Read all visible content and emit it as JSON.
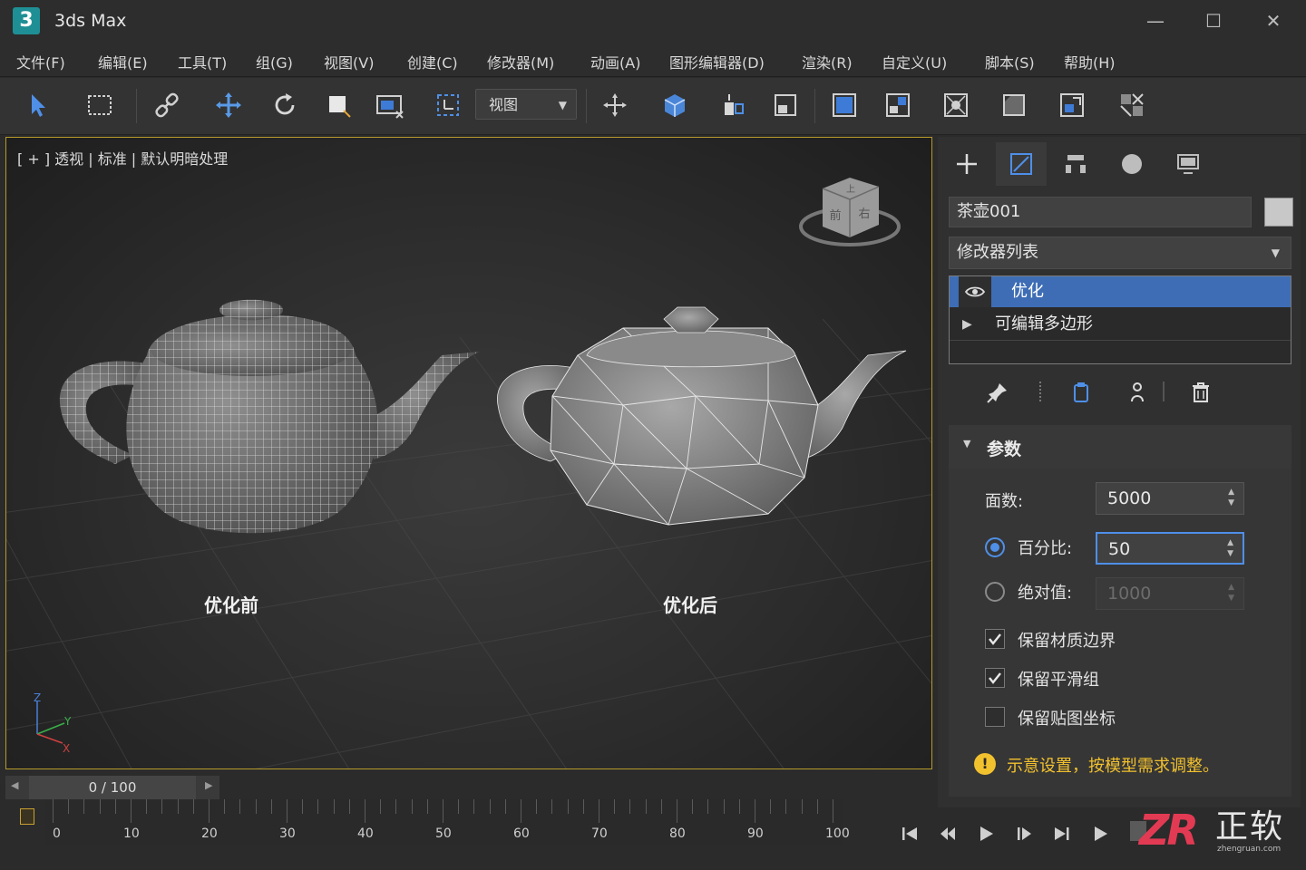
{
  "window": {
    "app_icon_text": "3",
    "title": "3ds Max"
  },
  "menu": [
    "文件(F)",
    "编辑(E)",
    "工具(T)",
    "组(G)",
    "视图(V)",
    "创建(C)",
    "修改器(M)",
    "动画(A)",
    "图形编辑器(D)",
    "渲染(R)",
    "自定义(U)",
    "脚本(S)",
    "帮助(H)"
  ],
  "toolbar": {
    "view_dropdown": "视图"
  },
  "viewport": {
    "label": "[ + ]  透视  |  标准  |  默认明暗处理",
    "caption_before": "优化前",
    "caption_after": "优化后",
    "viewcube": {
      "top": "上",
      "front": "前",
      "right": "右"
    },
    "axes": {
      "x": "X",
      "y": "Y",
      "z": "Z"
    }
  },
  "panel": {
    "object_name": "茶壶001",
    "modifier_list": "修改器列表",
    "stack": [
      {
        "label": "优化",
        "selected": true
      },
      {
        "label": "可编辑多边形",
        "selected": false
      }
    ],
    "rollout_title": "参数",
    "face_count_label": "面数:",
    "face_count": "5000",
    "percent_label": "百分比:",
    "percent": "50",
    "absolute_label": "绝对值:",
    "absolute": "1000",
    "mode_selected": "percent",
    "checkboxes": [
      {
        "label": "保留材质边界",
        "checked": true
      },
      {
        "label": "保留平滑组",
        "checked": true
      },
      {
        "label": "保留贴图坐标",
        "checked": false
      }
    ],
    "note": "示意设置，按模型需求调整。"
  },
  "timeline": {
    "frame_display": "0 / 100",
    "ticks": [
      "0",
      "10",
      "20",
      "30",
      "40",
      "50",
      "60",
      "70",
      "80",
      "90",
      "100"
    ]
  },
  "watermark": {
    "logo": "ZR",
    "text": "正软",
    "sub": "zhengruan.com"
  },
  "colors": {
    "accent_blue": "#3e6db5",
    "viewport_border": "#b59a2a",
    "note_yellow": "#f2c12e"
  }
}
